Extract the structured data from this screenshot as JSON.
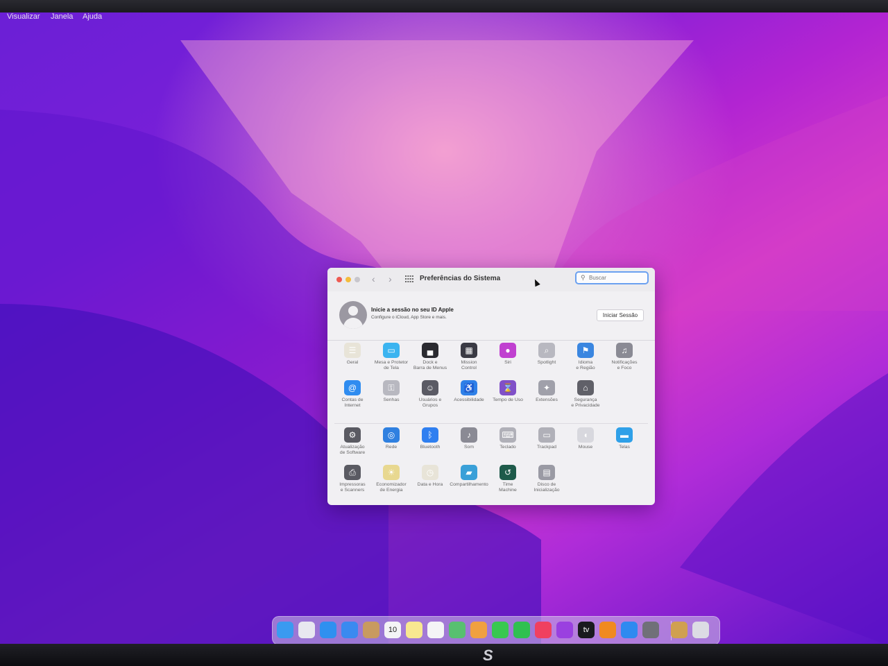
{
  "menubar": {
    "items": [
      "Visualizar",
      "Janela",
      "Ajuda"
    ]
  },
  "window": {
    "title": "Preferências do Sistema",
    "search_placeholder": "Buscar",
    "account": {
      "title": "Inicie a sessão no seu ID Apple",
      "subtitle": "Configure o iCloud, App Store e mais.",
      "button": "Iniciar Sessão"
    },
    "prefs": [
      {
        "label": "Geral",
        "icon": "general-icon",
        "color": "#e8e4d8"
      },
      {
        "label": "Mesa e Protetor\nde Tela",
        "icon": "desktop-icon",
        "color": "#3bb4f0"
      },
      {
        "label": "Dock e\nBarra de Menus",
        "icon": "dock-icon",
        "color": "#2a2a30"
      },
      {
        "label": "Mission\nControl",
        "icon": "mission-control-icon",
        "color": "#3a3a44"
      },
      {
        "label": "Siri",
        "icon": "siri-icon",
        "color": "#c040d0"
      },
      {
        "label": "Spotlight",
        "icon": "spotlight-icon",
        "color": "#b8b8c0"
      },
      {
        "label": "Idioma\ne Região",
        "icon": "globe-flag-icon",
        "color": "#3a86e0"
      },
      {
        "label": "Notificações\ne Foco",
        "icon": "bell-icon",
        "color": "#8a8a94"
      },
      {
        "label": "Contas de\nInternet",
        "icon": "at-icon",
        "color": "#2f8cf0"
      },
      {
        "label": "Senhas",
        "icon": "key-icon",
        "color": "#b8b8c0"
      },
      {
        "label": "Usuários e\nGrupos",
        "icon": "users-icon",
        "color": "#5a5a64"
      },
      {
        "label": "Acessibilidade",
        "icon": "accessibility-icon",
        "color": "#2f80e8"
      },
      {
        "label": "Tempo de Uso",
        "icon": "hourglass-icon",
        "color": "#8050c8"
      },
      {
        "label": "Extensões",
        "icon": "puzzle-icon",
        "color": "#a0a0aa"
      },
      {
        "label": "Segurança\ne Privacidade",
        "icon": "house-lock-icon",
        "color": "#606068"
      },
      {
        "label": "Atualização\nde Software",
        "icon": "gear-icon",
        "color": "#5a5a62"
      },
      {
        "label": "Rede",
        "icon": "network-globe-icon",
        "color": "#2f80e0"
      },
      {
        "label": "Bluetooth",
        "icon": "bluetooth-icon",
        "color": "#2f7ff0"
      },
      {
        "label": "Som",
        "icon": "speaker-icon",
        "color": "#8a8a94"
      },
      {
        "label": "Teclado",
        "icon": "keyboard-icon",
        "color": "#b0b0b8"
      },
      {
        "label": "Trackpad",
        "icon": "trackpad-icon",
        "color": "#b0b0b8"
      },
      {
        "label": "Mouse",
        "icon": "mouse-icon",
        "color": "#d8d8de"
      },
      {
        "label": "Telas",
        "icon": "display-icon",
        "color": "#2fa0e8"
      },
      {
        "label": "Impressoras\ne Scanners",
        "icon": "printer-icon",
        "color": "#5a5a62"
      },
      {
        "label": "Economizador\nde Energia",
        "icon": "lightbulb-icon",
        "color": "#e8d890"
      },
      {
        "label": "Data e Hora",
        "icon": "clock-icon",
        "color": "#e8e4d8"
      },
      {
        "label": "Compartilhamento",
        "icon": "folder-share-icon",
        "color": "#3aa0d8"
      },
      {
        "label": "Time\nMachine",
        "icon": "time-machine-icon",
        "color": "#1e5a4a"
      },
      {
        "label": "Disco de\nInicialização",
        "icon": "disk-icon",
        "color": "#9a9aa4"
      }
    ]
  },
  "dock": [
    {
      "name": "finder-icon",
      "color": "#3a9af0"
    },
    {
      "name": "launchpad-icon",
      "color": "#e8e8f0"
    },
    {
      "name": "safari-icon",
      "color": "#2f90f0"
    },
    {
      "name": "mail-icon",
      "color": "#3a8af0"
    },
    {
      "name": "contacts-icon",
      "color": "#c89a60"
    },
    {
      "name": "calendar-icon",
      "color": "#f4f4f6",
      "text": "10"
    },
    {
      "name": "notes-icon",
      "color": "#f8e890"
    },
    {
      "name": "reminders-icon",
      "color": "#f4f4f6"
    },
    {
      "name": "maps-icon",
      "color": "#58c070"
    },
    {
      "name": "photos-icon",
      "color": "#f0a040"
    },
    {
      "name": "messages-icon",
      "color": "#38c850"
    },
    {
      "name": "facetime-icon",
      "color": "#30c050"
    },
    {
      "name": "music-icon",
      "color": "#f04060"
    },
    {
      "name": "podcasts-icon",
      "color": "#9a40e0"
    },
    {
      "name": "tv-icon",
      "color": "#1a1a1e",
      "text": "tv"
    },
    {
      "name": "books-icon",
      "color": "#f08a20"
    },
    {
      "name": "app-store-icon",
      "color": "#2f8af0"
    },
    {
      "name": "system-preferences-icon",
      "color": "#707078"
    },
    {
      "name": "downloads-icon",
      "color": "#d0a050"
    },
    {
      "name": "trash-icon",
      "color": "#dcdce4"
    }
  ]
}
